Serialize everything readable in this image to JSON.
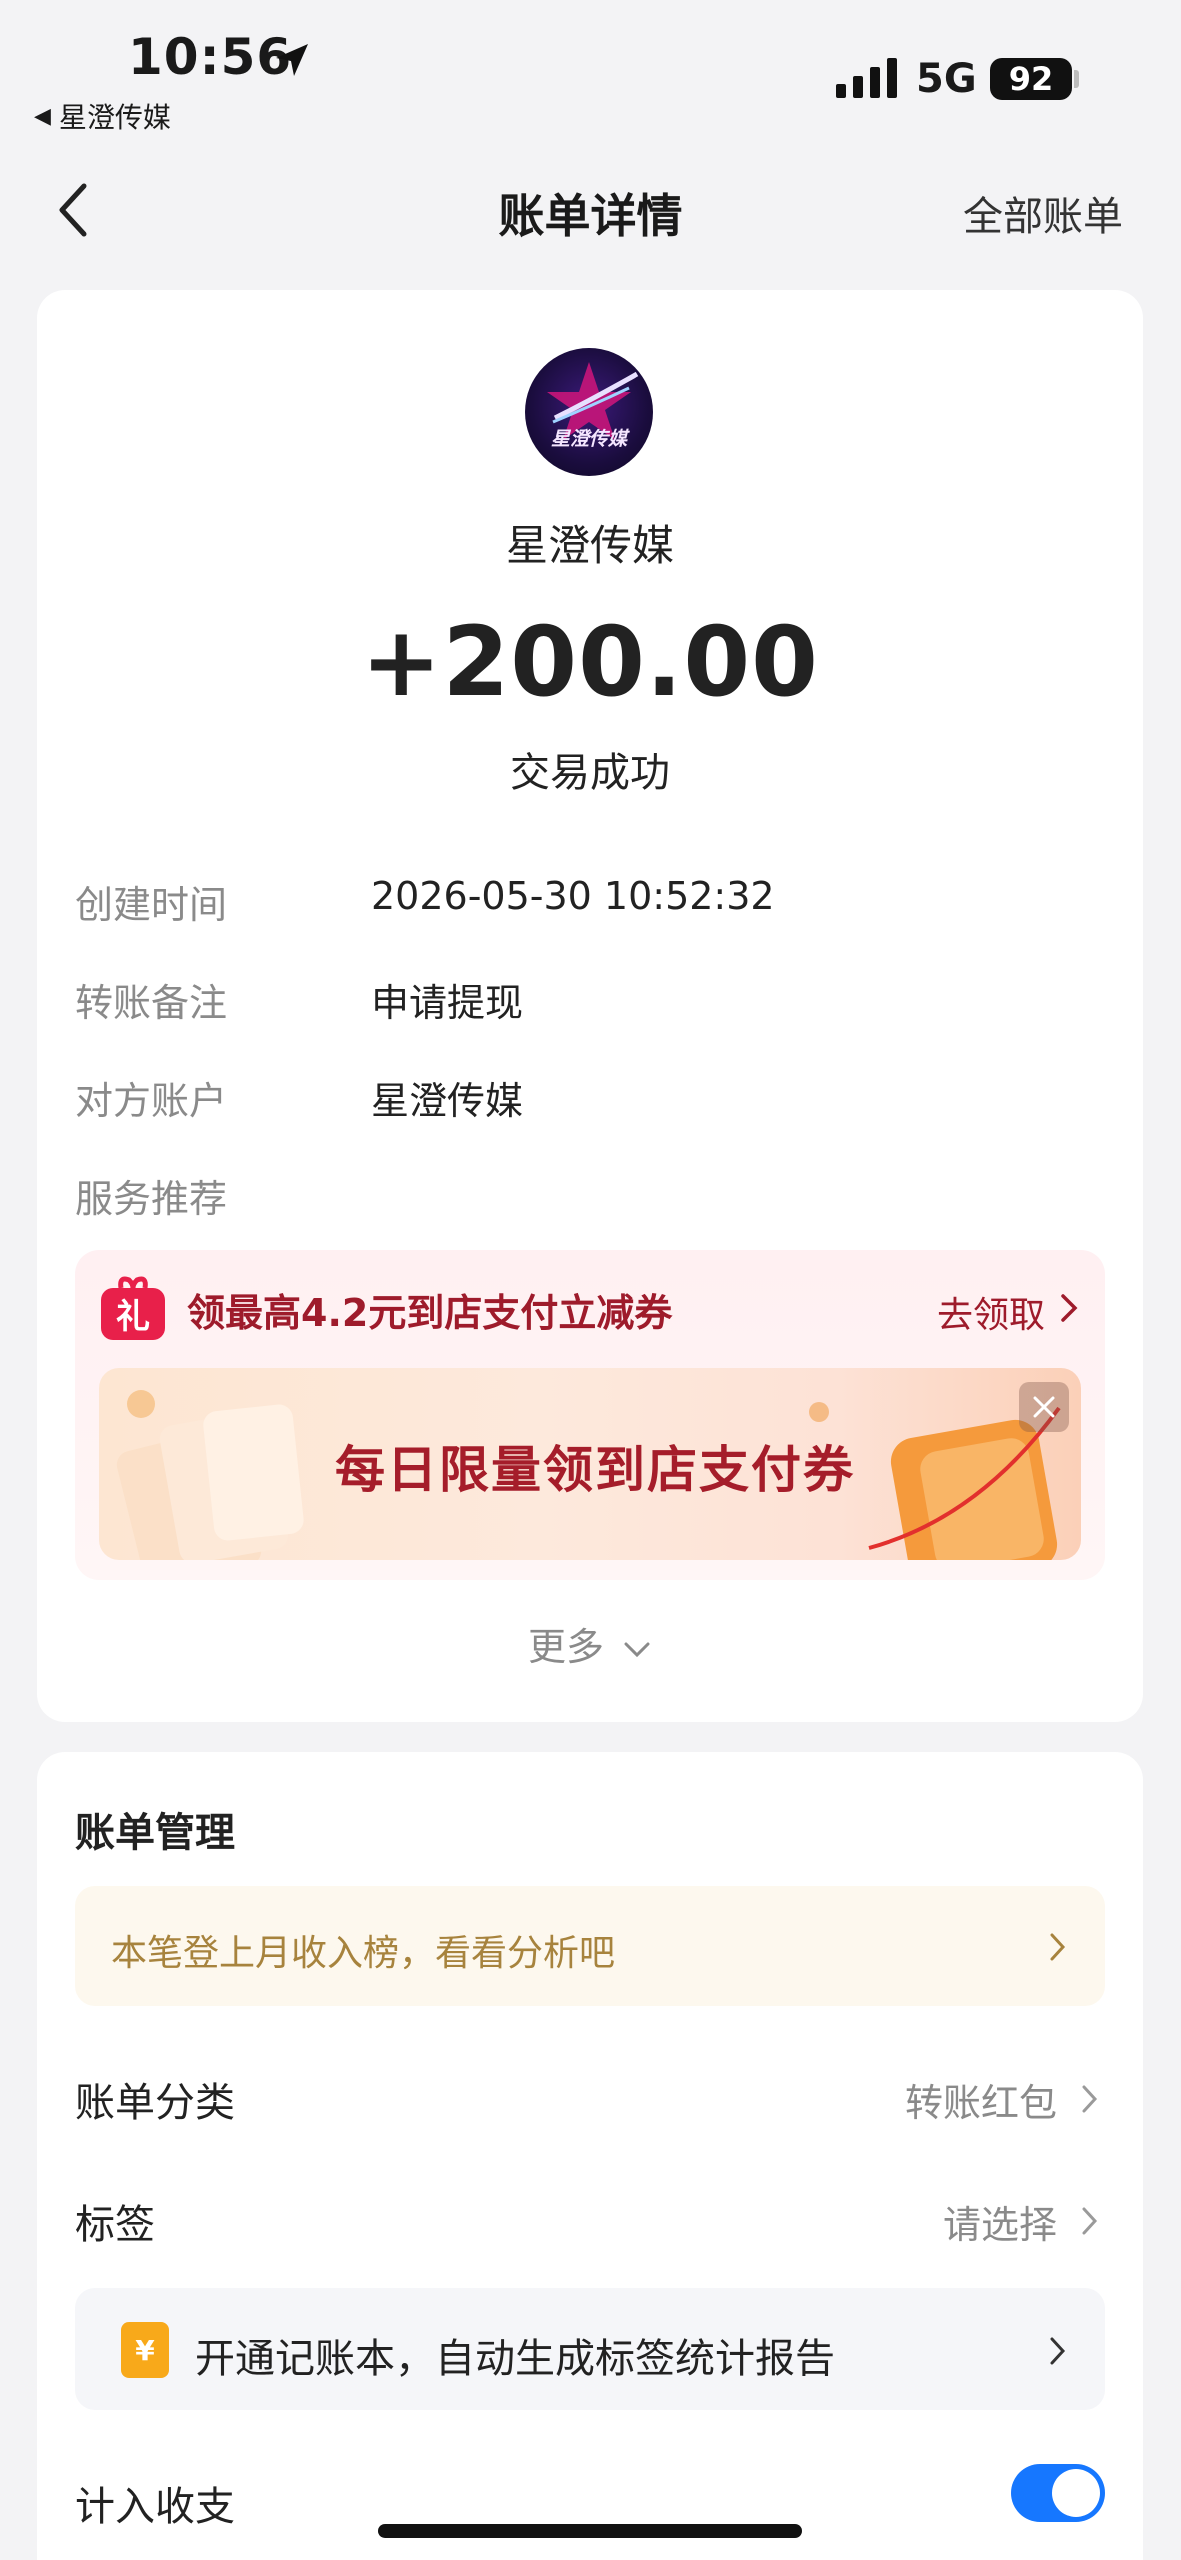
{
  "status_bar": {
    "time": "10:56",
    "back_app": "星澄传媒",
    "network": "5G",
    "battery": "92"
  },
  "nav": {
    "title": "账单详情",
    "right_link": "全部账单"
  },
  "summary": {
    "logo_text": "星澄传媒",
    "merchant": "星澄传媒",
    "amount": "+200.00",
    "status": "交易成功"
  },
  "details": [
    {
      "label": "创建时间",
      "value": "2026-05-30 10:52:32"
    },
    {
      "label": "转账备注",
      "value": "申请提现"
    },
    {
      "label": "对方账户",
      "value": "星澄传媒"
    },
    {
      "label": "服务推荐",
      "value": ""
    }
  ],
  "promo": {
    "gift_glyph": "礼",
    "title": "领最高4.2元到店支付立减券",
    "action": "去领取",
    "banner_text": "每日限量领到店支付券"
  },
  "more_label": "更多",
  "management": {
    "title": "账单管理",
    "tip": "本笔登上月收入榜，看看分析吧",
    "category_label": "账单分类",
    "category_value": "转账红包",
    "tag_label": "标签",
    "tag_value": "请选择",
    "book_icon_glyph": "¥",
    "book_text": "开通记账本，自动生成标签统计报告",
    "count_label": "计入收支",
    "count_enabled": true
  },
  "colors": {
    "accent": "#1677ff",
    "promo_red": "#9e1b2b",
    "tip_gold": "#a7833d"
  }
}
